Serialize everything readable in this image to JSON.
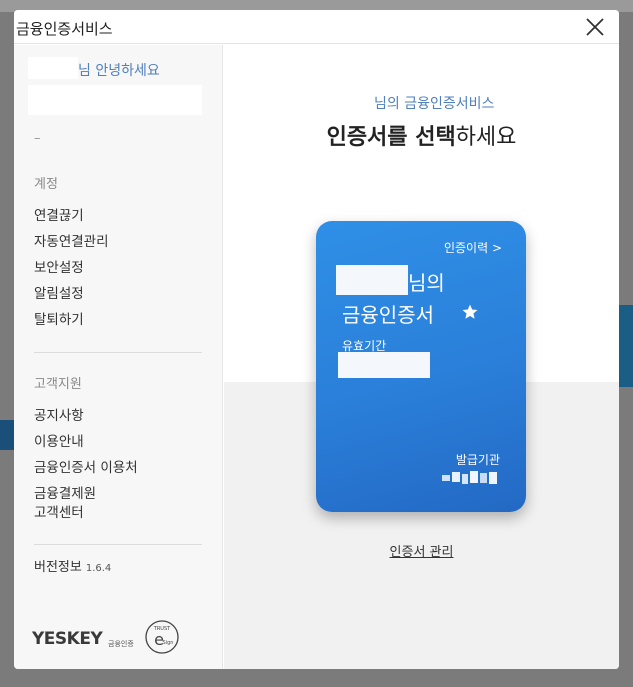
{
  "window": {
    "title": "금융인증서비스"
  },
  "sidebar": {
    "greeting": "님 안녕하세요",
    "dash": "–",
    "account_section": "계정",
    "account_items": [
      "연결끊기",
      "자동연결관리",
      "보안설정",
      "알림설정",
      "탈퇴하기"
    ],
    "support_section": "고객지원",
    "support_items": [
      "공지사항",
      "이용안내",
      "금융인증서 이용처",
      "금융결제원\n고객센터"
    ],
    "version_label": "버전정보",
    "version_number": "1.6.4",
    "logo": {
      "brand": "YESKEY",
      "brand_sub": "금융인증",
      "seal_top": "TRUST",
      "seal_mark": "e",
      "seal_bottom": "Sign"
    }
  },
  "main": {
    "subtitle": "님의 금융인증서비스",
    "headline_bold": "인증서를 선택",
    "headline_rest": "하세요",
    "card": {
      "history_link": "인증이력 >",
      "title_line1": "님의",
      "title_line2": "금융인증서",
      "valid_label": "유효기간",
      "issuer_label": "발급기관"
    },
    "manage_link": "인증서 관리"
  },
  "colors": {
    "accent": "#4f7fbd",
    "card_blue": "#2a7fd9"
  }
}
